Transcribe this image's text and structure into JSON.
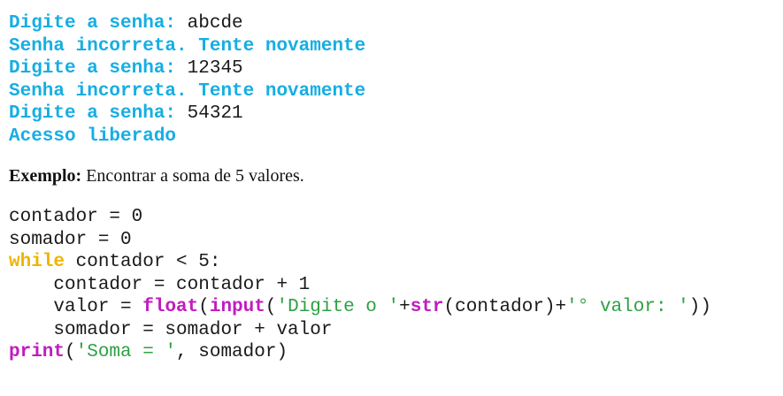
{
  "output": {
    "lines": [
      {
        "prompt": "Digite a senha: ",
        "input": "abcde"
      },
      {
        "message": "Senha incorreta. Tente novamente"
      },
      {
        "prompt": "Digite a senha: ",
        "input": "12345"
      },
      {
        "message": "Senha incorreta. Tente novamente"
      },
      {
        "prompt": "Digite a senha: ",
        "input": "54321"
      },
      {
        "message": "Acesso liberado"
      }
    ]
  },
  "example": {
    "label": "Exemplo:",
    "text": " Encontrar a soma de 5 valores."
  },
  "code": {
    "line1": "contador = 0",
    "line2": "somador = 0",
    "line3_kw": "while",
    "line3_rest": " contador < 5:",
    "line4": "    contador = contador + 1",
    "line5_a": "    valor = ",
    "line5_float": "float",
    "line5_b": "(",
    "line5_input": "input",
    "line5_c": "(",
    "line5_str1": "'Digite o '",
    "line5_d": "+",
    "line5_str": "str",
    "line5_e": "(contador)+",
    "line5_str2": "'° valor: '",
    "line5_f": "))",
    "line6": "    somador = somador + valor",
    "line7_print": "print",
    "line7_a": "(",
    "line7_str": "'Soma = '",
    "line7_b": ", somador)"
  },
  "colors": {
    "output_text": "#16aee3",
    "keyword": "#f0b400",
    "builtin": "#c01cc0",
    "string": "#2ea043"
  }
}
